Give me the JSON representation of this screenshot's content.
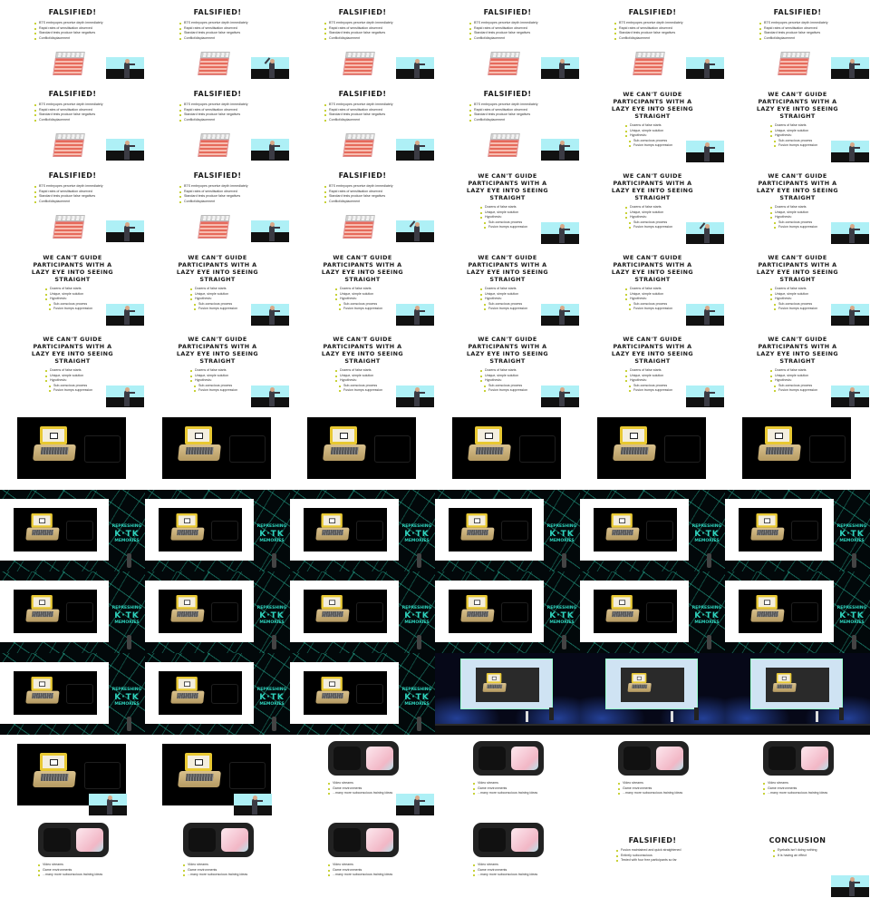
{
  "falsified": {
    "title": "FALSIFIED!",
    "bullets": [
      "BTS embryopes perceive depth immediately",
      "Rapid rates of sensitisation observed",
      "Standard tests produce false negatives",
      "Conflict/displacement"
    ]
  },
  "lazy_eye": {
    "title": "WE CAN'T GUIDE PARTICIPANTS WITH A LAZY EYE INTO SEEING STRAIGHT",
    "bullets": [
      "Dozens of false starts",
      "Unique, simple solution",
      "Hypothesis:"
    ],
    "sub_bullets": [
      "Sub-conscious process",
      "Fusion trumps suppression"
    ]
  },
  "brand": {
    "top": "REPRESHING",
    "mid": "K·TK",
    "bottom": "MEMORIES"
  },
  "goggles": {
    "bullets": [
      "Video streams",
      "Game environments",
      "...many more subconscious training ideas"
    ]
  },
  "falsified_final": {
    "title": "FALSIFIED!",
    "bullets": [
      "Fusion maintained and quick straightened",
      "Entirely subconscious",
      "Tested with four free participants so far"
    ]
  },
  "conclusion": {
    "title": "CONCLUSION",
    "bullets": [
      "Eyeballs isn't doing nothing",
      "It is having an effect"
    ]
  },
  "colors": {
    "accent": "#c8d23a",
    "sky": "#aef0f6",
    "laptop_yellow": "#e8c832",
    "brand_teal": "#2fd3bd"
  },
  "icons": [
    "laptop-icon",
    "presenter-icon",
    "goggles-icon"
  ]
}
